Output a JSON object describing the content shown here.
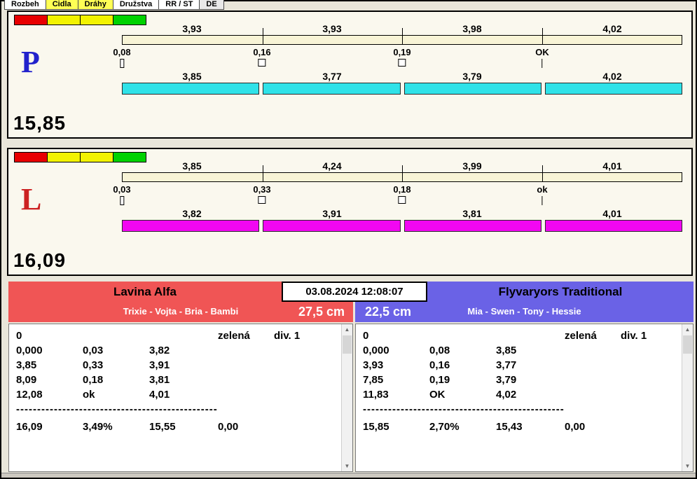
{
  "tabs": [
    {
      "label": "Rozbeh",
      "bg": "#ffffff"
    },
    {
      "label": "Cidla",
      "bg": "#ffff55"
    },
    {
      "label": "Dráhy",
      "bg": "#ffff55"
    },
    {
      "label": "Družstva",
      "bg": "#ffffff"
    },
    {
      "label": "RR / ST",
      "bg": "#ffffff"
    },
    {
      "label": "DE",
      "bg": "#e9e9e9"
    }
  ],
  "lanes": [
    {
      "letter": "P",
      "letter_color": "#2222cc",
      "bar_color": "#2fe2e8",
      "total": "15,85",
      "lights": [
        "#e80000",
        "#f2f200",
        "#f2f200",
        "#00d200"
      ],
      "splits_top": [
        "3,93",
        "3,93",
        "3,98",
        "4,02"
      ],
      "deltas": [
        "0,08",
        "0,16",
        "0,19",
        "OK"
      ],
      "splits_bottom": [
        "3,85",
        "3,77",
        "3,79",
        "4,02"
      ]
    },
    {
      "letter": "L",
      "letter_color": "#cc2222",
      "bar_color": "#f207f2",
      "total": "16,09",
      "lights": [
        "#e80000",
        "#f2f200",
        "#f2f200",
        "#00d200"
      ],
      "splits_top": [
        "3,85",
        "4,24",
        "3,99",
        "4,01"
      ],
      "deltas": [
        "0,03",
        "0,33",
        "0,18",
        "ok"
      ],
      "splits_bottom": [
        "3,82",
        "3,91",
        "3,81",
        "4,01"
      ]
    }
  ],
  "timestamp": "03.08.2024 12:08:07",
  "icons": {
    "scroll_up": "▲",
    "scroll_down": "▼"
  },
  "teams": [
    {
      "name": "Lavina Alfa",
      "members": "Trixie - Vojta - Bria - Bambi",
      "height": "27,5 cm",
      "color": "#f05555",
      "rows": [
        {
          "c0": "0",
          "c3": "zelená",
          "c4": "div. 1"
        },
        {
          "c0": "0,000",
          "c1": "0,03",
          "c2": "3,82"
        },
        {
          "c0": "3,85",
          "c1": "0,33",
          "c2": "3,91"
        },
        {
          "c0": "8,09",
          "c1": "0,18",
          "c2": "3,81"
        },
        {
          "c0": "12,08",
          "c1": "ok",
          "c2": "4,01"
        }
      ],
      "separator": "--------------------------------------------------",
      "summary": {
        "c0": "16,09",
        "c1": "3,49%",
        "c2": "15,55",
        "c3": "0,00"
      }
    },
    {
      "name": "Flyvaryors Traditional",
      "members": "Mia - Swen - Tony - Hessie",
      "height": "22,5 cm",
      "color": "#6a62e6",
      "rows": [
        {
          "c0": "0",
          "c3": "zelená",
          "c4": "div. 1"
        },
        {
          "c0": "0,000",
          "c1": "0,08",
          "c2": "3,85"
        },
        {
          "c0": "3,93",
          "c1": "0,16",
          "c2": "3,77"
        },
        {
          "c0": "7,85",
          "c1": "0,19",
          "c2": "3,79"
        },
        {
          "c0": "11,83",
          "c1": "OK",
          "c2": "4,02"
        }
      ],
      "separator": "--------------------------------------------------",
      "summary": {
        "c0": "15,85",
        "c1": "2,70%",
        "c2": "15,43",
        "c3": "0,00"
      }
    }
  ]
}
